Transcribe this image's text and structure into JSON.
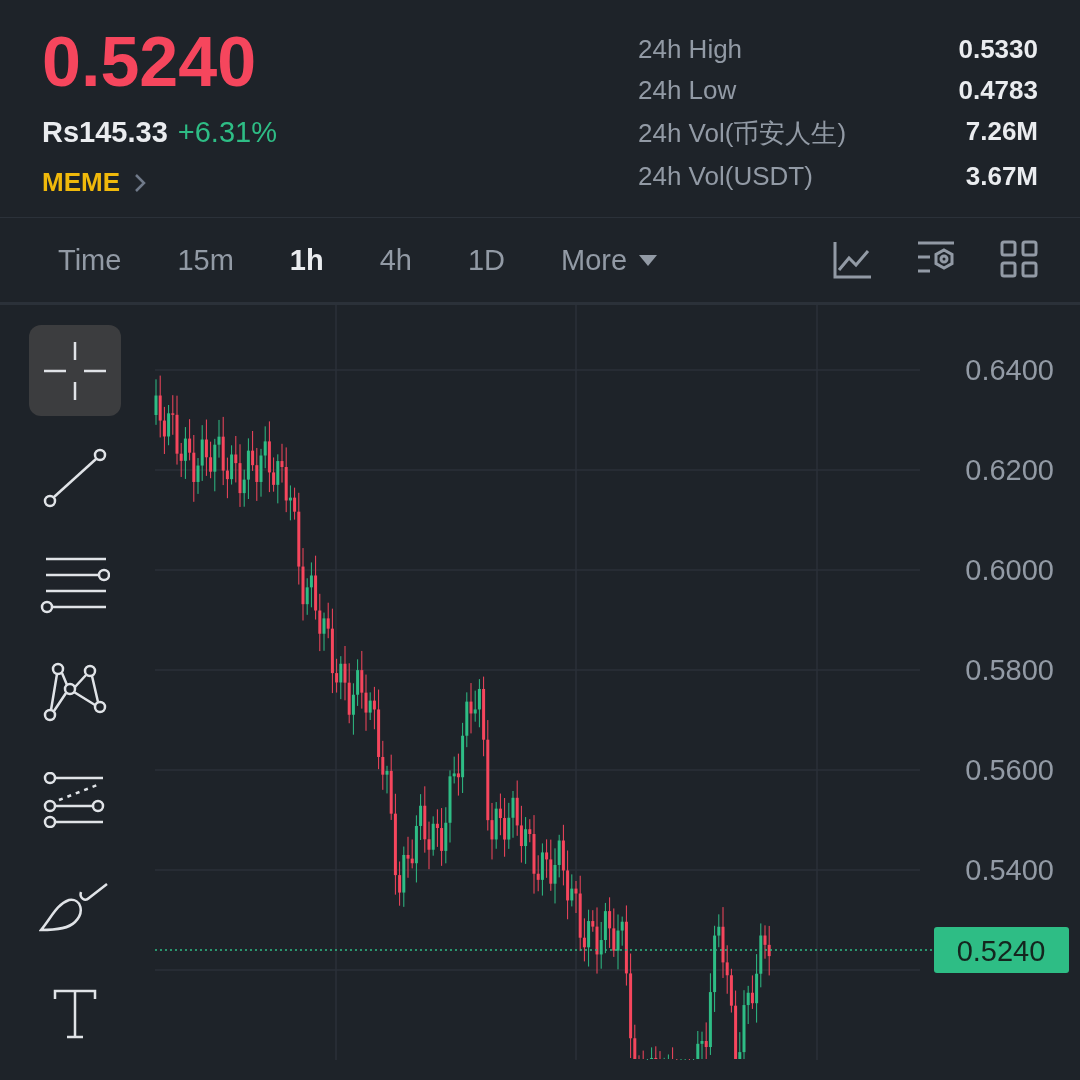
{
  "header": {
    "price": "0.5240",
    "fiat_price": "Rs145.33",
    "change": "+6.31%",
    "tag": "MEME",
    "stats": [
      {
        "label": "24h High",
        "value": "0.5330"
      },
      {
        "label": "24h Low",
        "value": "0.4783"
      },
      {
        "label": "24h Vol(币安人生)",
        "value": "7.26M"
      },
      {
        "label": "24h Vol(USDT)",
        "value": "3.67M"
      }
    ]
  },
  "timeframes": [
    {
      "label": "Time",
      "selected": false,
      "kind": "plain"
    },
    {
      "label": "15m",
      "selected": false,
      "kind": "plain"
    },
    {
      "label": "1h",
      "selected": true,
      "kind": "plain"
    },
    {
      "label": "4h",
      "selected": false,
      "kind": "plain"
    },
    {
      "label": "1D",
      "selected": false,
      "kind": "plain"
    },
    {
      "label": "More",
      "selected": false,
      "kind": "dropdown"
    }
  ],
  "tools": [
    {
      "kind": "crosshair",
      "selected": true
    },
    {
      "kind": "line",
      "selected": false
    },
    {
      "kind": "parallel",
      "selected": false
    },
    {
      "kind": "pattern",
      "selected": false
    },
    {
      "kind": "fib",
      "selected": false
    },
    {
      "kind": "brush",
      "selected": false
    },
    {
      "kind": "text",
      "selected": false
    }
  ],
  "chart": {
    "y_labels": [
      "0.6400",
      "0.6200",
      "0.6000",
      "0.5800",
      "0.5600",
      "0.5400"
    ],
    "current_price": "0.5240"
  }
}
